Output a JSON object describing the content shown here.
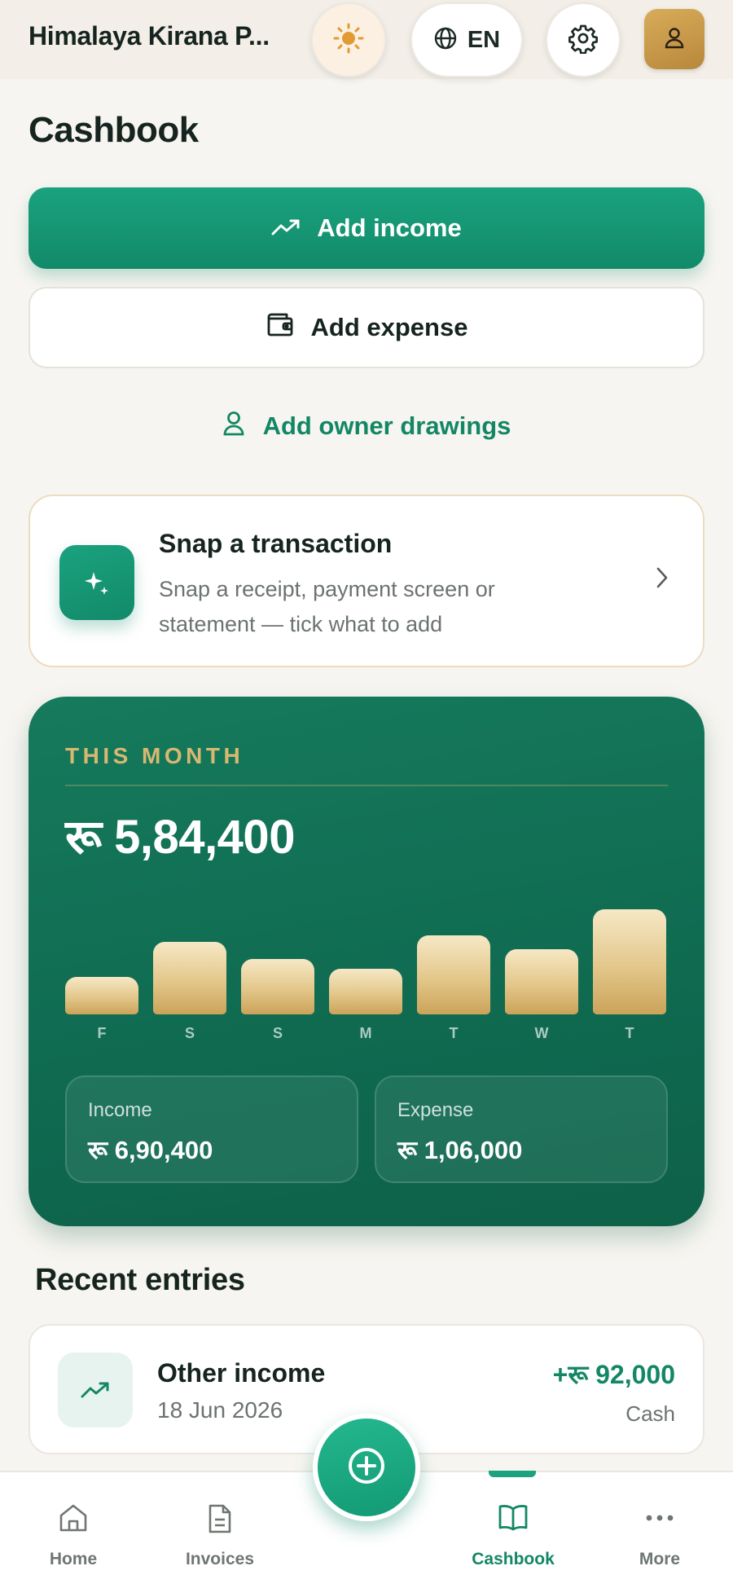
{
  "header": {
    "shop_name": "Himalaya Kirana P...",
    "language": "EN",
    "icons": {
      "theme": "sun-icon",
      "language": "globe-icon",
      "settings": "gear-icon",
      "profile": "user-icon"
    }
  },
  "page": {
    "title": "Cashbook"
  },
  "actions": {
    "add_income": "Add income",
    "add_expense": "Add expense",
    "add_owner_drawings": "Add owner drawings"
  },
  "snap": {
    "title": "Snap a transaction",
    "subtitle": "Snap a receipt, payment screen or statement — tick what to add"
  },
  "month": {
    "label": "THIS MONTH",
    "total": "रू 5,84,400",
    "income_label": "Income",
    "income_value": "रू 6,90,400",
    "expense_label": "Expense",
    "expense_value": "रू 1,06,000"
  },
  "chart_data": {
    "type": "bar",
    "categories": [
      "F",
      "S",
      "S",
      "M",
      "T",
      "W",
      "T"
    ],
    "values": [
      36,
      70,
      54,
      44,
      77,
      63,
      102
    ],
    "title": "",
    "xlabel": "",
    "ylabel": ""
  },
  "recent": {
    "title": "Recent entries",
    "entries": [
      {
        "title": "Other income",
        "date": "18 Jun 2026",
        "amount": "+रू 92,000",
        "method": "Cash",
        "icon": "trending-up-icon"
      }
    ]
  },
  "nav": {
    "items": [
      {
        "label": "Home",
        "icon": "home-icon"
      },
      {
        "label": "Invoices",
        "icon": "document-icon"
      },
      {
        "label": "Cashbook",
        "icon": "book-icon",
        "active": true
      },
      {
        "label": "More",
        "icon": "more-dots-icon"
      }
    ]
  },
  "colors": {
    "primary": "#128a6a",
    "accent_gold": "#d8b870",
    "card_green": "#0f6a50"
  }
}
